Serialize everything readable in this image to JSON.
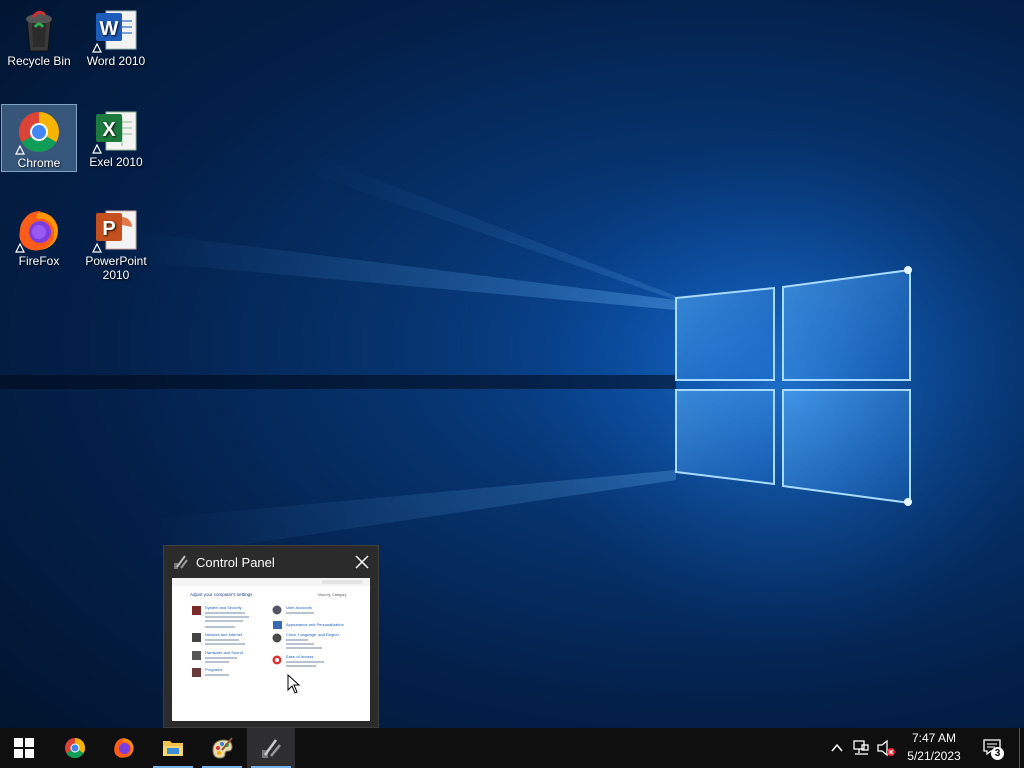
{
  "desktop": {
    "icons": [
      {
        "label": "Recycle Bin"
      },
      {
        "label": "Word 2010"
      },
      {
        "label": "Chrome"
      },
      {
        "label": "Exel 2010"
      },
      {
        "label": "FireFox"
      },
      {
        "label": "PowerPoint 2010"
      }
    ]
  },
  "preview": {
    "title": "Control Panel",
    "thumb": {
      "heading": "Adjust your computer's settings",
      "view_by": "View by:  Category",
      "categories_left": [
        "System and Security",
        "Network and Internet",
        "Hardware and Sound",
        "Programs"
      ],
      "categories_right": [
        "User Accounts",
        "Appearance and Personalization",
        "Clock, Language, and Region",
        "Ease of Access"
      ]
    }
  },
  "taskbar": {
    "time": "7:47 AM",
    "date": "5/21/2023",
    "notification_count": "3"
  },
  "colors": {
    "taskbar": "#0f0f10",
    "accent": "#78b4ea",
    "preview_bg": "#2b2b2b"
  }
}
